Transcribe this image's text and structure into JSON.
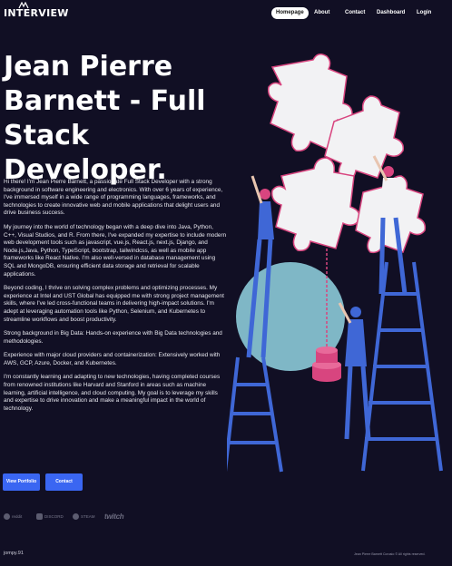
{
  "header": {
    "logo_text": "INTERVIEW",
    "nav": [
      {
        "label": "Homepage",
        "active": true
      },
      {
        "label": "About",
        "active": false
      },
      {
        "label": "Contact",
        "active": false
      },
      {
        "label": "Dashboard",
        "active": false
      },
      {
        "label": "Login",
        "active": false
      }
    ]
  },
  "hero": {
    "title": "Jean Pierre Barnett - Full Stack Developer.",
    "paragraphs": [
      "Hi there! I'm Jean Pierre Barnett, a passionate Full Stack Developer with a strong background in software engineering and electronics. With over 6 years of experience, I've immersed myself in a wide range of programming languages, frameworks, and technologies to create innovative web and mobile applications that delight users and drive business success.",
      "My journey into the world of technology began with a deep dive into Java, Python, C++, Visual Studios, and R. From there, I've expanded my expertise to include modern web development tools such as javascript, vue.js, React.js, next.js, Django, and Node.js,Java, Python, TypeScript, bootstrap, tailwindcss, as well as mobile app frameworks like React Native. I'm also well-versed in database management using SQL and MongoDB, ensuring efficient data storage and retrieval for scalable applications.",
      "Beyond coding, I thrive on solving complex problems and optimizing processes. My experience at Intel and UST Global has equipped me with strong project management skills, where I've led cross-functional teams in delivering high-impact solutions. I'm adept at leveraging automation tools like Python, Selenium, and Kubernetes to streamline workflows and boost productivity.",
      "Strong background in Big Data: Hands-on experience with Big Data technologies and methodologies.",
      "Experience with major cloud providers and containerization: Extensively worked with AWS, GCP, Azure, Docker, and Kubernetes.",
      "I'm constantly learning and adapting to new technologies, having completed courses from renowned institutions like Harvard and Stanford in areas such as machine learning, artificial intelligence, and cloud computing. My goal is to leverage my skills and expertise to drive innovation and make a meaningful impact in the world of technology."
    ],
    "buttons": {
      "portfolio": "View Portfolio",
      "contact": "Contact"
    }
  },
  "brands": [
    {
      "label": "reddit",
      "icon": "reddit-icon"
    },
    {
      "label": "DISCORD",
      "icon": "discord-icon"
    },
    {
      "label": "STEAM",
      "icon": "steam-icon"
    },
    {
      "label": "twitch",
      "icon": "twitch-icon"
    }
  ],
  "footer": {
    "left": "jompy.91",
    "right": "Jean Pierre Barnett Corusio © All rights reserved."
  },
  "colors": {
    "background": "#110f24",
    "accent": "#3a66f2",
    "illustration_blue": "#3f67d6",
    "illustration_teal": "#7fb7c6",
    "illustration_pink": "#d8457f"
  }
}
